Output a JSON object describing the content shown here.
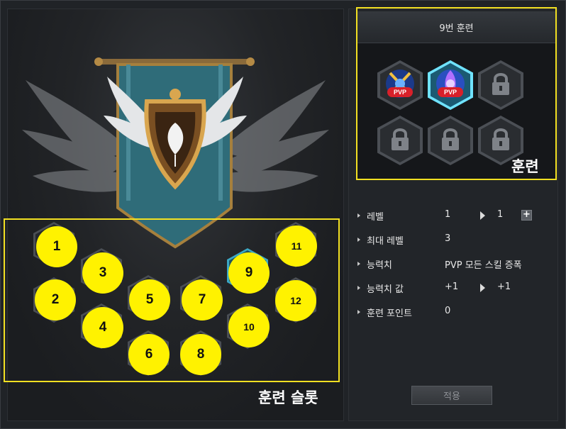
{
  "training_slots": {
    "caption": "훈련 슬롯",
    "slots": [
      {
        "num": "1"
      },
      {
        "num": "2"
      },
      {
        "num": "3"
      },
      {
        "num": "4"
      },
      {
        "num": "5"
      },
      {
        "num": "6"
      },
      {
        "num": "7"
      },
      {
        "num": "8"
      },
      {
        "num": "9",
        "active": true
      },
      {
        "num": "10"
      },
      {
        "num": "11"
      },
      {
        "num": "12"
      }
    ]
  },
  "training_panel": {
    "title": "9번 훈련",
    "caption": "훈련",
    "skills": [
      {
        "icon": "pvp-swords-icon",
        "tag": "PVP",
        "state": "unlocked"
      },
      {
        "icon": "pvp-aura-icon",
        "tag": "PVP",
        "state": "selected"
      },
      {
        "icon": "lock-icon",
        "state": "locked"
      },
      {
        "icon": "lock-icon",
        "state": "locked"
      },
      {
        "icon": "lock-icon",
        "state": "locked"
      },
      {
        "icon": "lock-icon",
        "state": "locked"
      }
    ]
  },
  "stats": {
    "level": {
      "label": "레벨",
      "current": "1",
      "next": "1"
    },
    "max_level": {
      "label": "최대 레벨",
      "value": "3"
    },
    "ability": {
      "label": "능력치",
      "value": "PVP 모든 스킬 증폭"
    },
    "ability_value": {
      "label": "능력치 값",
      "current": "+1",
      "next": "+1"
    },
    "training_points": {
      "label": "훈련 포인트",
      "value": "0"
    }
  },
  "apply_button": {
    "label": "적용"
  },
  "colors": {
    "highlight": "#f2e022",
    "active_slot": "#3ba7c4",
    "selected_skill": "#6fe3ff",
    "pvp_badge": "#d8202a"
  }
}
